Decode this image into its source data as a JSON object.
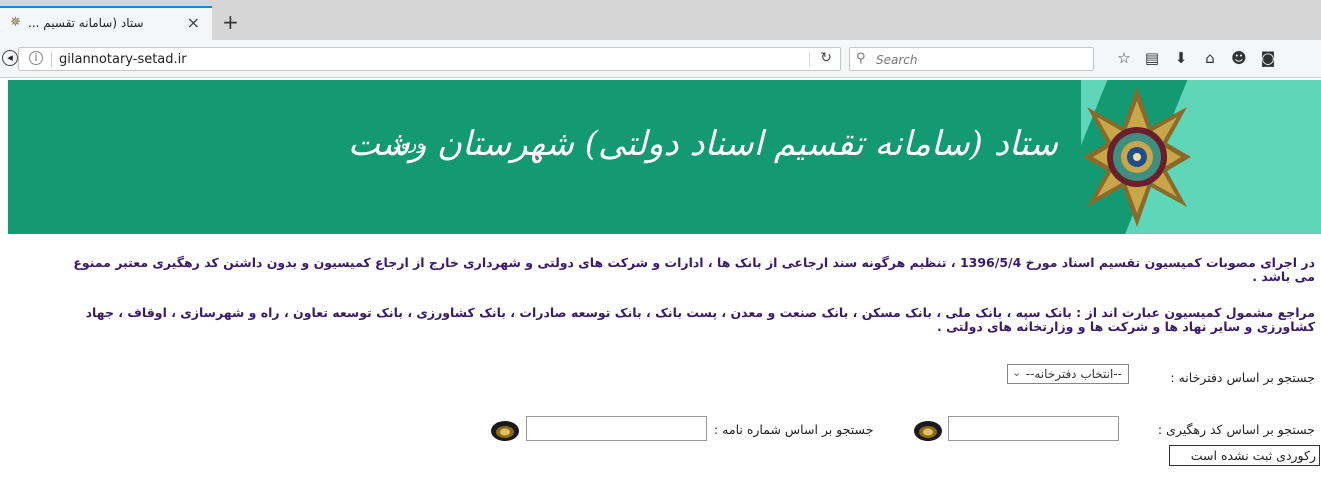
{
  "browser": {
    "tab_title": "ستاد (سامانه تقسیم ...",
    "url": "gilannotary-setad.ir",
    "search_placeholder": "Search"
  },
  "icons": {
    "tab_favicon": "star-emblem-icon",
    "tab_close": "close-icon",
    "new_tab": "plus-icon",
    "back": "back-arrow-icon",
    "info": "info-icon",
    "reload": "reload-icon",
    "search": "magnifier-icon",
    "toolbar": [
      "star-icon",
      "reading-list-icon",
      "download-icon",
      "home-icon",
      "pocket-icon",
      "shield-icon"
    ]
  },
  "banner": {
    "title": "ستاد (سامانه تقسیم اسناد دولتی) شهرستان رشت",
    "login": "ورود",
    "colors": {
      "main": "#149a72",
      "accent": "#5fd6b8"
    }
  },
  "content": {
    "notice1": "در اجرای مصوبات کمیسیون تقسیم اسناد مورخ 1396/5/4 ، تنظیم هرگونه سند ارجاعی از بانک ها ، ادارات و شرکت های دولتی و شهرداری خارج از ارجاع کمیسیون و بدون داشتن کد رهگیری معتبر ممنوع می باشد .",
    "notice2": "مراجع مشمول کمیسیون عبارت اند از : بانک سپه ، بانک ملی ، بانک مسکن ، بانک صنعت و معدن ، پست بانک ، بانک توسعه صادرات ، بانک کشاورزی ، بانک توسعه تعاون ، راه و شهرسازی ، اوقاف ، جهاد کشاورزی و سایر نهاد ها و شرکت ها و وزارتخانه های دولتی .",
    "office_search_label": "جستجو بر اساس دفترخانه :",
    "office_select_value": "--انتخاب دفترخانه--",
    "tracking_label": "جستجو بر اساس کد رهگیری :",
    "letter_label": "جستجو بر اساس شماره نامه :",
    "status": "رکوردی ثبت نشده است",
    "text_color": "#3a1a6e"
  }
}
